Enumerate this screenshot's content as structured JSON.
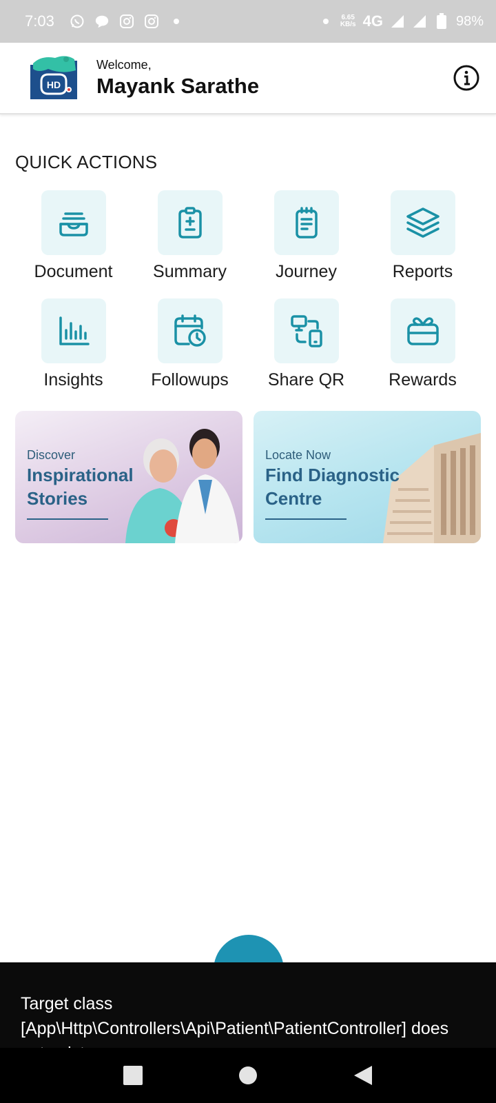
{
  "status_bar": {
    "time": "7:03",
    "speed_value": "6.65",
    "speed_unit": "KB/s",
    "network": "4G",
    "battery": "98%"
  },
  "header": {
    "logo_text": "HD",
    "welcome": "Welcome,",
    "user_name": "Mayank Sarathe"
  },
  "quick_actions": {
    "title": "QUICK ACTIONS",
    "items": [
      {
        "label": "Document",
        "icon": "inbox-tray-icon"
      },
      {
        "label": "Summary",
        "icon": "clipboard-plus-icon"
      },
      {
        "label": "Journey",
        "icon": "notepad-icon"
      },
      {
        "label": "Reports",
        "icon": "layers-icon"
      },
      {
        "label": "Insights",
        "icon": "bar-chart-icon"
      },
      {
        "label": "Followups",
        "icon": "calendar-clock-icon"
      },
      {
        "label": "Share QR",
        "icon": "share-devices-icon"
      },
      {
        "label": "Rewards",
        "icon": "gift-icon"
      }
    ]
  },
  "banners": [
    {
      "kicker": "Discover",
      "title": "Inspirational Stories"
    },
    {
      "kicker": "Locate Now",
      "title": "Find Diagnostic Centre"
    }
  ],
  "toast": {
    "message": "Target class [App\\Http\\Controllers\\Api\\Patient\\PatientController] does not exist."
  },
  "colors": {
    "accent": "#1a91a6",
    "tile_bg": "#e8f6f8",
    "banner_title": "#2a6287",
    "fab": "#1e93b3"
  }
}
